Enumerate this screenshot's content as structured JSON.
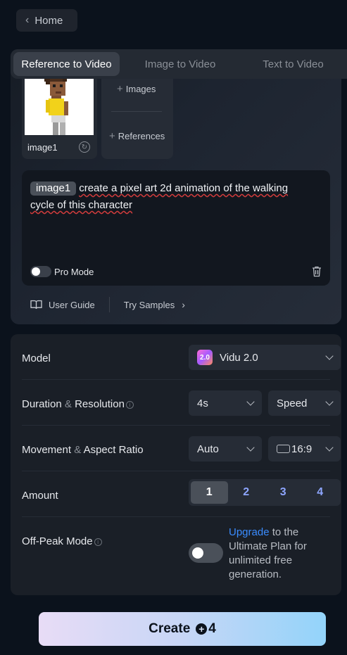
{
  "home": {
    "label": "Home"
  },
  "tabs": [
    {
      "label": "Reference to Video",
      "active": true
    },
    {
      "label": "Image to Video",
      "active": false
    },
    {
      "label": "Text to Video",
      "active": false
    }
  ],
  "references": {
    "image_label": "image1",
    "add_images": "Images",
    "add_references": "References"
  },
  "prompt": {
    "chip": "image1",
    "text_line1": "create a pixel art 2d animation of the walking",
    "text_line2": "cycle of this character",
    "pro_mode_label": "Pro Mode"
  },
  "links": {
    "user_guide": "User Guide",
    "try_samples": "Try Samples"
  },
  "settings": {
    "model": {
      "label": "Model",
      "value": "Vidu 2.0",
      "badge": "2.0"
    },
    "duration": {
      "label_a": "Duration",
      "amp": "&",
      "label_b": "Resolution",
      "duration_value": "4s",
      "resolution_value": "Speed"
    },
    "movement": {
      "label_a": "Movement",
      "amp": "&",
      "label_b": "Aspect Ratio",
      "movement_value": "Auto",
      "ratio_value": "16:9"
    },
    "amount": {
      "label": "Amount",
      "options": [
        "1",
        "2",
        "3",
        "4"
      ],
      "selected": "1"
    },
    "offpeak": {
      "label": "Off-Peak Mode",
      "link": "Upgrade",
      "text": "to the Ultimate Plan for unlimited free generation."
    }
  },
  "create": {
    "label": "Create",
    "cost": "4"
  },
  "colors": {
    "accent_link": "#3a8cff",
    "amount_text": "#8ea6ff",
    "background": "#0b121c"
  }
}
